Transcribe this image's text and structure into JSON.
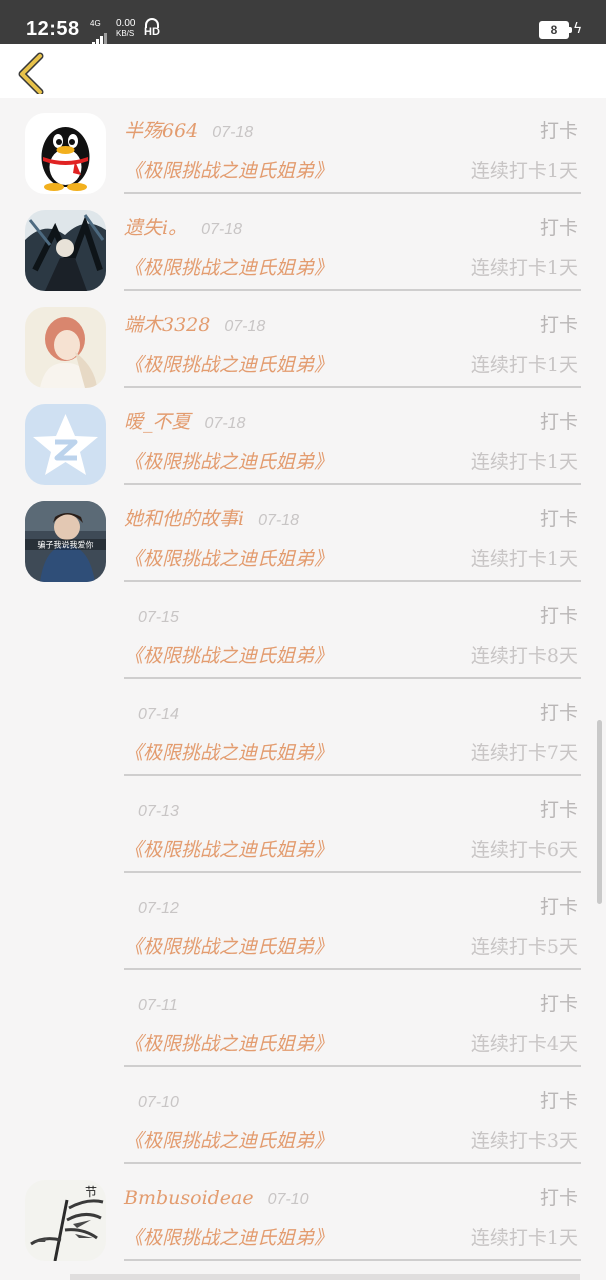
{
  "status_bar": {
    "time": "12:58",
    "network": "4G",
    "speed_value": "0.00",
    "speed_unit": "KB/S",
    "hd": "HD",
    "battery": "8"
  },
  "nav": {
    "back_icon": "chevron-left-icon",
    "accent": "#e8c24a"
  },
  "colors": {
    "accent_orange": "#e39c6f",
    "muted": "#c8c5c5",
    "action_gray": "#b9b6b6"
  },
  "checkins": [
    {
      "user": "半殇664",
      "date": "07-18",
      "action": "打卡",
      "title": "《极限挑战之迪氏姐弟》",
      "streak": "连续打卡1天",
      "avatar": "qq-penguin-icon"
    },
    {
      "user": "遗失i。",
      "date": "07-18",
      "action": "打卡",
      "title": "《极限挑战之迪氏姐弟》",
      "streak": "连续打卡1天",
      "avatar": "anime-art-avatar"
    },
    {
      "user": "端木3328",
      "date": "07-18",
      "action": "打卡",
      "title": "《极限挑战之迪氏姐弟》",
      "streak": "连续打卡1天",
      "avatar": "anime-girl-avatar"
    },
    {
      "user": "暧_不夏",
      "date": "07-18",
      "action": "打卡",
      "title": "《极限挑战之迪氏姐弟》",
      "streak": "连续打卡1天",
      "avatar": "qzone-star-icon"
    },
    {
      "user": "她和他的故事i",
      "date": "07-18",
      "action": "打卡",
      "title": "《极限挑战之迪氏姐弟》",
      "streak": "连续打卡1天",
      "avatar": "photo-avatar",
      "avatar_caption": "骗子我说我爱你"
    },
    {
      "user": "",
      "date": "07-15",
      "action": "打卡",
      "title": "《极限挑战之迪氏姐弟》",
      "streak": "连续打卡8天"
    },
    {
      "user": "",
      "date": "07-14",
      "action": "打卡",
      "title": "《极限挑战之迪氏姐弟》",
      "streak": "连续打卡7天"
    },
    {
      "user": "",
      "date": "07-13",
      "action": "打卡",
      "title": "《极限挑战之迪氏姐弟》",
      "streak": "连续打卡6天"
    },
    {
      "user": "",
      "date": "07-12",
      "action": "打卡",
      "title": "《极限挑战之迪氏姐弟》",
      "streak": "连续打卡5天"
    },
    {
      "user": "",
      "date": "07-11",
      "action": "打卡",
      "title": "《极限挑战之迪氏姐弟》",
      "streak": "连续打卡4天"
    },
    {
      "user": "",
      "date": "07-10",
      "action": "打卡",
      "title": "《极限挑战之迪氏姐弟》",
      "streak": "连续打卡3天"
    },
    {
      "user": "Bmbusoideae",
      "date": "07-10",
      "action": "打卡",
      "title": "《极限挑战之迪氏姐弟》",
      "streak": "连续打卡1天",
      "avatar": "bamboo-painting-avatar",
      "avatar_caption": "节"
    }
  ]
}
